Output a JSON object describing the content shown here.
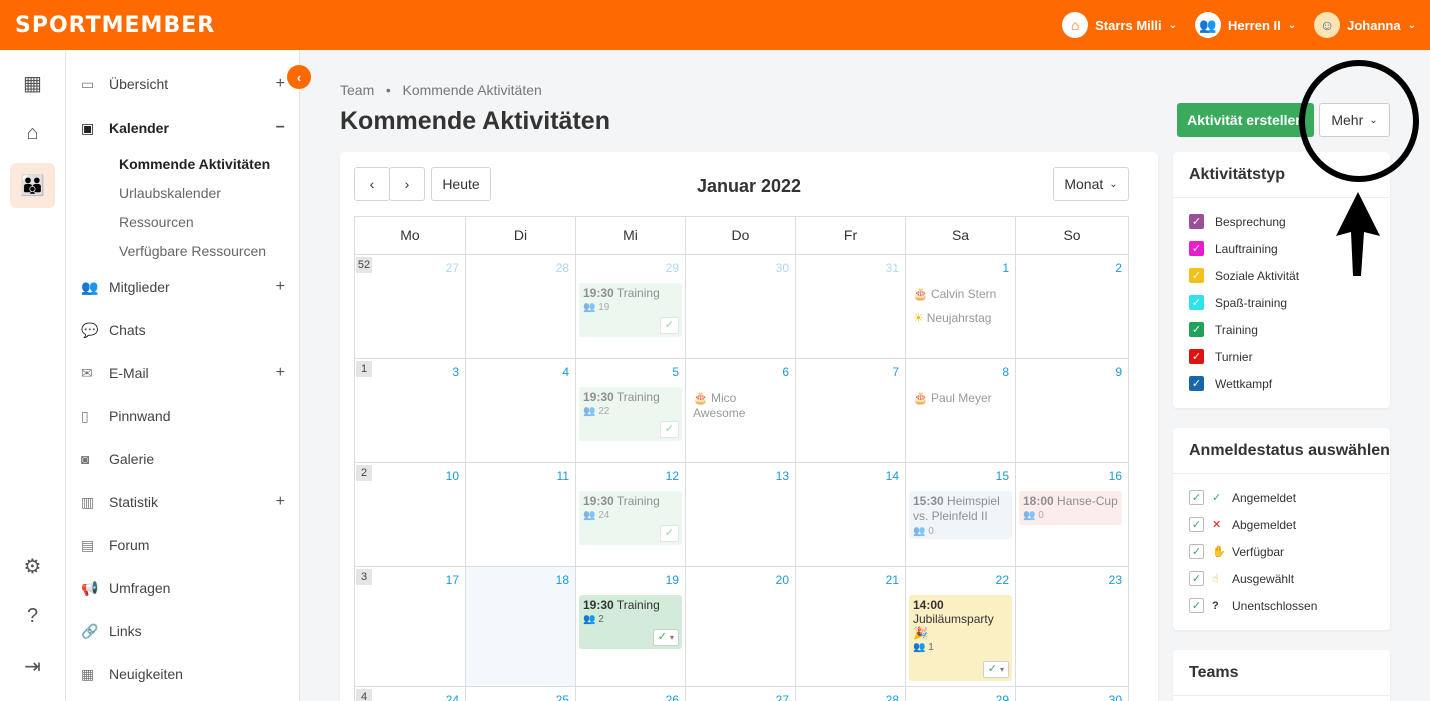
{
  "app": {
    "logo": "SPORTMEMBER"
  },
  "topnav": [
    {
      "label": "Starrs Milli",
      "icon": "home-icon"
    },
    {
      "label": "Herren II",
      "icon": "team-icon"
    },
    {
      "label": "Johanna",
      "icon": "user-avatar"
    }
  ],
  "sidebar": {
    "items": [
      {
        "label": "Übersicht",
        "icon": "overview-icon",
        "expand": "+"
      },
      {
        "label": "Kalender",
        "icon": "calendar-icon",
        "expand": "−"
      },
      {
        "label": "Mitglieder",
        "icon": "members-icon",
        "expand": "+"
      },
      {
        "label": "Chats",
        "icon": "chat-icon"
      },
      {
        "label": "E-Mail",
        "icon": "mail-icon",
        "expand": "+"
      },
      {
        "label": "Pinnwand",
        "icon": "board-icon"
      },
      {
        "label": "Galerie",
        "icon": "camera-icon"
      },
      {
        "label": "Statistik",
        "icon": "stats-icon",
        "expand": "+"
      },
      {
        "label": "Forum",
        "icon": "forum-icon"
      },
      {
        "label": "Umfragen",
        "icon": "megaphone-icon"
      },
      {
        "label": "Links",
        "icon": "link-icon"
      },
      {
        "label": "Neuigkeiten",
        "icon": "news-icon"
      }
    ],
    "calendar_sub": [
      "Kommende Aktivitäten",
      "Urlaubskalender",
      "Ressourcen",
      "Verfügbare Ressourcen"
    ]
  },
  "page": {
    "breadcrumb": [
      "Team",
      "Kommende Aktivitäten"
    ],
    "title": "Kommende Aktivitäten",
    "create_label": "Aktivität erstellen",
    "more_label": "Mehr"
  },
  "calendar": {
    "month_label": "Januar 2022",
    "today_label": "Heute",
    "view_label": "Monat",
    "weekdays": [
      "Mo",
      "Di",
      "Mi",
      "Do",
      "Fr",
      "Sa",
      "So"
    ],
    "weeks": [
      {
        "no": "52",
        "days": [
          "27",
          "28",
          "29",
          "30",
          "31",
          "1",
          "2"
        ]
      },
      {
        "no": "1",
        "days": [
          "3",
          "4",
          "5",
          "6",
          "7",
          "8",
          "9"
        ]
      },
      {
        "no": "2",
        "days": [
          "10",
          "11",
          "12",
          "13",
          "14",
          "15",
          "16"
        ]
      },
      {
        "no": "3",
        "days": [
          "17",
          "18",
          "19",
          "20",
          "21",
          "22",
          "23"
        ]
      },
      {
        "no": "4",
        "days": [
          "24",
          "25",
          "26",
          "27",
          "28",
          "29",
          "30"
        ]
      }
    ],
    "events": {
      "w0_training": {
        "time": "19:30",
        "title": "Training",
        "count": "19"
      },
      "w1_training": {
        "time": "19:30",
        "title": "Training",
        "count": "22"
      },
      "w2_training": {
        "time": "19:30",
        "title": "Training",
        "count": "24"
      },
      "w3_training": {
        "time": "19:30",
        "title": "Training",
        "count": "2"
      },
      "w2_spiel": {
        "time": "15:30",
        "title": "Heimspiel vs. Pleinfeld II",
        "count": "0"
      },
      "w2_cup": {
        "time": "18:00",
        "title": "Hanse-Cup",
        "count": "0"
      },
      "w3_party": {
        "time": "14:00",
        "title": "Jubiläumsparty",
        "emoji": "🎉",
        "count": "1"
      }
    },
    "birthdays": {
      "calvin": "Calvin Stern",
      "neujahr": "Neujahrstag",
      "mico": "Mico Awesome",
      "paul": "Paul Meyer"
    }
  },
  "activity_types": {
    "title": "Aktivitätstyp",
    "items": [
      {
        "label": "Besprechung",
        "color": "#9b4f96"
      },
      {
        "label": "Lauftraining",
        "color": "#e91ec9"
      },
      {
        "label": "Soziale Aktivität",
        "color": "#f2c21b"
      },
      {
        "label": "Spaß-training",
        "color": "#2fe3ee"
      },
      {
        "label": "Training",
        "color": "#1fa35a"
      },
      {
        "label": "Turnier",
        "color": "#e01212"
      },
      {
        "label": "Wettkampf",
        "color": "#1867a8"
      }
    ]
  },
  "signup_status": {
    "title": "Anmeldestatus auswählen",
    "items": [
      {
        "label": "Angemeldet",
        "icon": "✓",
        "color": "#3aaa5c"
      },
      {
        "label": "Abgemeldet",
        "icon": "✕",
        "color": "#e01212"
      },
      {
        "label": "Verfügbar",
        "icon": "✋",
        "color": "#f29a1b"
      },
      {
        "label": "Ausgewählt",
        "icon": "☝",
        "color": "#f29a1b"
      },
      {
        "label": "Unentschlossen",
        "icon": "?",
        "color": "#333333"
      }
    ]
  },
  "teams_panel": {
    "title": "Teams"
  }
}
